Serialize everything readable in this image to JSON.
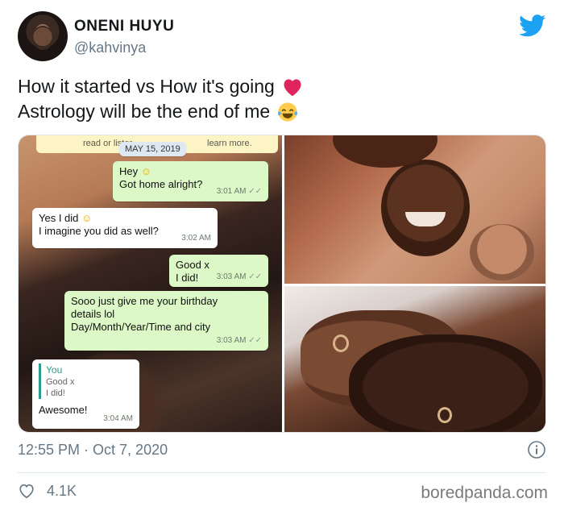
{
  "author": {
    "display_name": "ONENI HUYU",
    "handle": "@kahvinya",
    "avatar_icon": "profile-avatar"
  },
  "tweet": {
    "line1": "How it started vs How it's going",
    "line1_emoji": "red-heart",
    "line2": "Astrology will be the end of me",
    "line2_emoji": "tears-of-joy"
  },
  "chat": {
    "banner_text_left": "read or lister",
    "banner_text_right": "learn more.",
    "date": "MAY 15, 2019",
    "messages": [
      {
        "dir": "out",
        "lines": [
          "Hey",
          "Got home alright?"
        ],
        "time": "3:01 AM"
      },
      {
        "dir": "in",
        "lines": [
          "Yes I did",
          "I imagine you did as well?"
        ],
        "time": "3:02 AM"
      },
      {
        "dir": "out",
        "lines": [
          "Good x",
          "I did!"
        ],
        "time": "3:03 AM"
      },
      {
        "dir": "out",
        "lines": [
          "Sooo just give me your birthday",
          "details lol",
          "Day/Month/Year/Time and city"
        ],
        "time": "3:03 AM"
      },
      {
        "dir": "in",
        "quote_author": "You",
        "quote_lines": [
          "Good x",
          "I did!"
        ],
        "lines": [
          "Awesome!"
        ],
        "time": "3:04 AM"
      }
    ]
  },
  "footer": {
    "timestamp": "12:55 PM · Oct 7, 2020",
    "likes": "4.1K",
    "watermark": "boredpanda.com"
  },
  "colors": {
    "twitter_blue": "#1da1f2",
    "heart_red": "#e0245e",
    "whatsapp_out": "#dcf8c6",
    "secondary_text": "#657786"
  }
}
